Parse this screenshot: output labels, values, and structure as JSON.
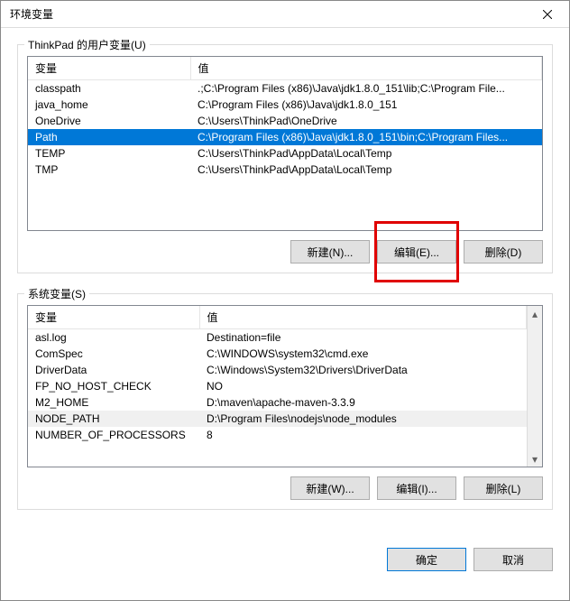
{
  "window": {
    "title": "环境变量"
  },
  "user_vars": {
    "legend": "ThinkPad 的用户变量(U)",
    "headers": {
      "name": "变量",
      "value": "值"
    },
    "rows": [
      {
        "name": "classpath",
        "value": ".;C:\\Program Files (x86)\\Java\\jdk1.8.0_151\\lib;C:\\Program File..."
      },
      {
        "name": "java_home",
        "value": "C:\\Program Files (x86)\\Java\\jdk1.8.0_151"
      },
      {
        "name": "OneDrive",
        "value": "C:\\Users\\ThinkPad\\OneDrive"
      },
      {
        "name": "Path",
        "value": "C:\\Program Files (x86)\\Java\\jdk1.8.0_151\\bin;C:\\Program Files...",
        "selected": true
      },
      {
        "name": "TEMP",
        "value": "C:\\Users\\ThinkPad\\AppData\\Local\\Temp"
      },
      {
        "name": "TMP",
        "value": "C:\\Users\\ThinkPad\\AppData\\Local\\Temp"
      }
    ],
    "buttons": {
      "new": "新建(N)...",
      "edit": "编辑(E)...",
      "delete": "删除(D)"
    }
  },
  "system_vars": {
    "legend": "系统变量(S)",
    "headers": {
      "name": "变量",
      "value": "值"
    },
    "rows": [
      {
        "name": "asl.log",
        "value": "Destination=file"
      },
      {
        "name": "ComSpec",
        "value": "C:\\WINDOWS\\system32\\cmd.exe"
      },
      {
        "name": "DriverData",
        "value": "C:\\Windows\\System32\\Drivers\\DriverData"
      },
      {
        "name": "FP_NO_HOST_CHECK",
        "value": "NO"
      },
      {
        "name": "M2_HOME",
        "value": "D:\\maven\\apache-maven-3.3.9"
      },
      {
        "name": "NODE_PATH",
        "value": "D:\\Program Files\\nodejs\\node_modules",
        "highlighted": true
      },
      {
        "name": "NUMBER_OF_PROCESSORS",
        "value": "8"
      }
    ],
    "buttons": {
      "new": "新建(W)...",
      "edit": "编辑(I)...",
      "delete": "删除(L)"
    }
  },
  "dialog_buttons": {
    "ok": "确定",
    "cancel": "取消"
  }
}
